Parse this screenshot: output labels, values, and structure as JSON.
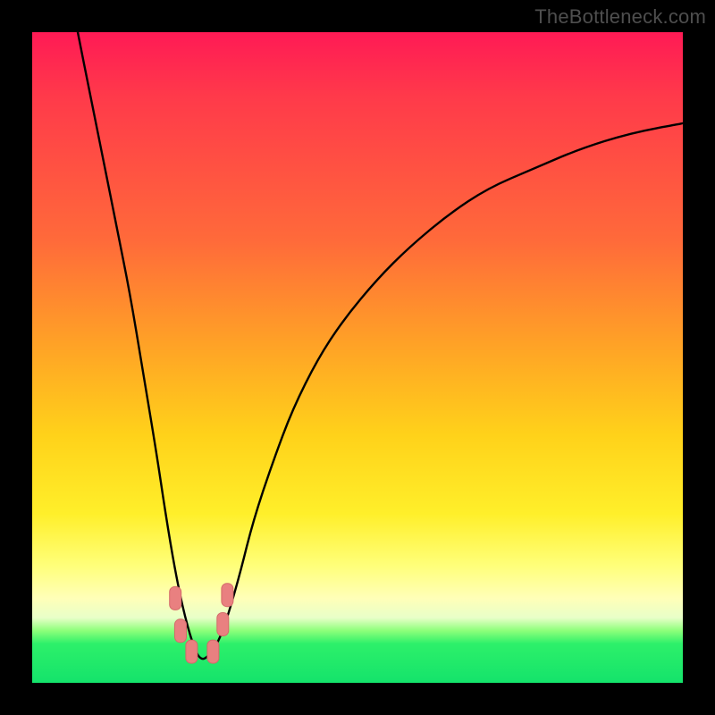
{
  "watermark": "TheBottleneck.com",
  "colors": {
    "frame": "#000000",
    "grad_top": "#ff1a55",
    "grad_mid1": "#ff6a3a",
    "grad_mid2": "#ffd21a",
    "grad_yellow": "#ffff7a",
    "grad_green": "#14e36b",
    "curve": "#000000",
    "marker": "#e98080",
    "marker_stroke": "#d46a6a"
  },
  "chart_data": {
    "type": "line",
    "title": "",
    "xlabel": "",
    "ylabel": "",
    "x_range": [
      0,
      100
    ],
    "y_range": [
      0,
      100
    ],
    "note": "x and y are normalized to percent of plot area; y=0 is bottom (green), y=100 is top (red). Curve is a V with minimum near x≈26.",
    "series": [
      {
        "name": "bottleneck-curve",
        "x": [
          7,
          9,
          11,
          13,
          15,
          17,
          19,
          20.5,
          22,
          23.5,
          25,
          26,
          27,
          28.5,
          30,
          32,
          34,
          37,
          40,
          44,
          48,
          53,
          58,
          64,
          70,
          77,
          84,
          92,
          100
        ],
        "y": [
          100,
          90,
          80,
          70,
          60,
          48,
          36,
          26,
          17,
          10,
          5,
          3.5,
          4,
          6,
          10,
          17,
          25,
          34,
          42,
          50,
          56,
          62,
          67,
          72,
          76,
          79,
          82,
          84.5,
          86
        ]
      }
    ],
    "markers": {
      "name": "highlight-points",
      "shape": "rounded-rect",
      "points": [
        {
          "x": 22.0,
          "y": 13.0
        },
        {
          "x": 22.8,
          "y": 8.0
        },
        {
          "x": 24.5,
          "y": 4.8
        },
        {
          "x": 27.8,
          "y": 4.8
        },
        {
          "x": 29.3,
          "y": 9.0
        },
        {
          "x": 30.0,
          "y": 13.5
        }
      ]
    }
  }
}
